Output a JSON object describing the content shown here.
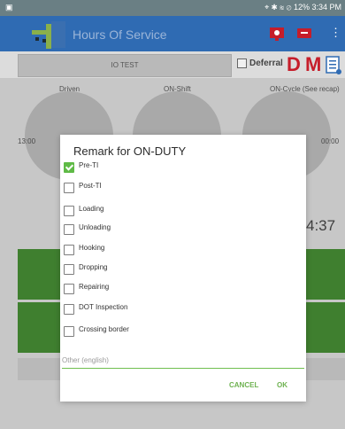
{
  "status_bar": {
    "left_icon": "image-icon",
    "right_text": "12% 3:34 PM"
  },
  "app_bar": {
    "title": "Hours Of Service"
  },
  "tab": {
    "label": "IO TEST"
  },
  "deferral": {
    "label": "Deferral"
  },
  "letters": {
    "d": "D",
    "m": "M"
  },
  "gauges": {
    "driven_label": "Driven",
    "onshift_label": "ON-Shift",
    "oncycle_label": "ON-Cycle (See recap)",
    "left_time": "13:00",
    "right_time": "00:00",
    "clock_fragment": "4:37"
  },
  "dialog": {
    "title": "Remark for ON-DUTY",
    "options": [
      {
        "label": "Pre-TI",
        "checked": true
      },
      {
        "label": "Post-TI",
        "checked": false
      },
      {
        "label": "Loading",
        "checked": false
      },
      {
        "label": "Unloading",
        "checked": false
      },
      {
        "label": "Hooking",
        "checked": false
      },
      {
        "label": "Dropping",
        "checked": false
      },
      {
        "label": "Repairing",
        "checked": false
      },
      {
        "label": "DOT Inspection",
        "checked": false
      },
      {
        "label": "Crossing border",
        "checked": false
      }
    ],
    "other_placeholder": "Other (english)",
    "cancel_label": "CANCEL",
    "ok_label": "OK"
  },
  "colors": {
    "app_blue": "#2f6bb3",
    "accent_green": "#5fba46",
    "alert_red": "#c61d2a"
  }
}
